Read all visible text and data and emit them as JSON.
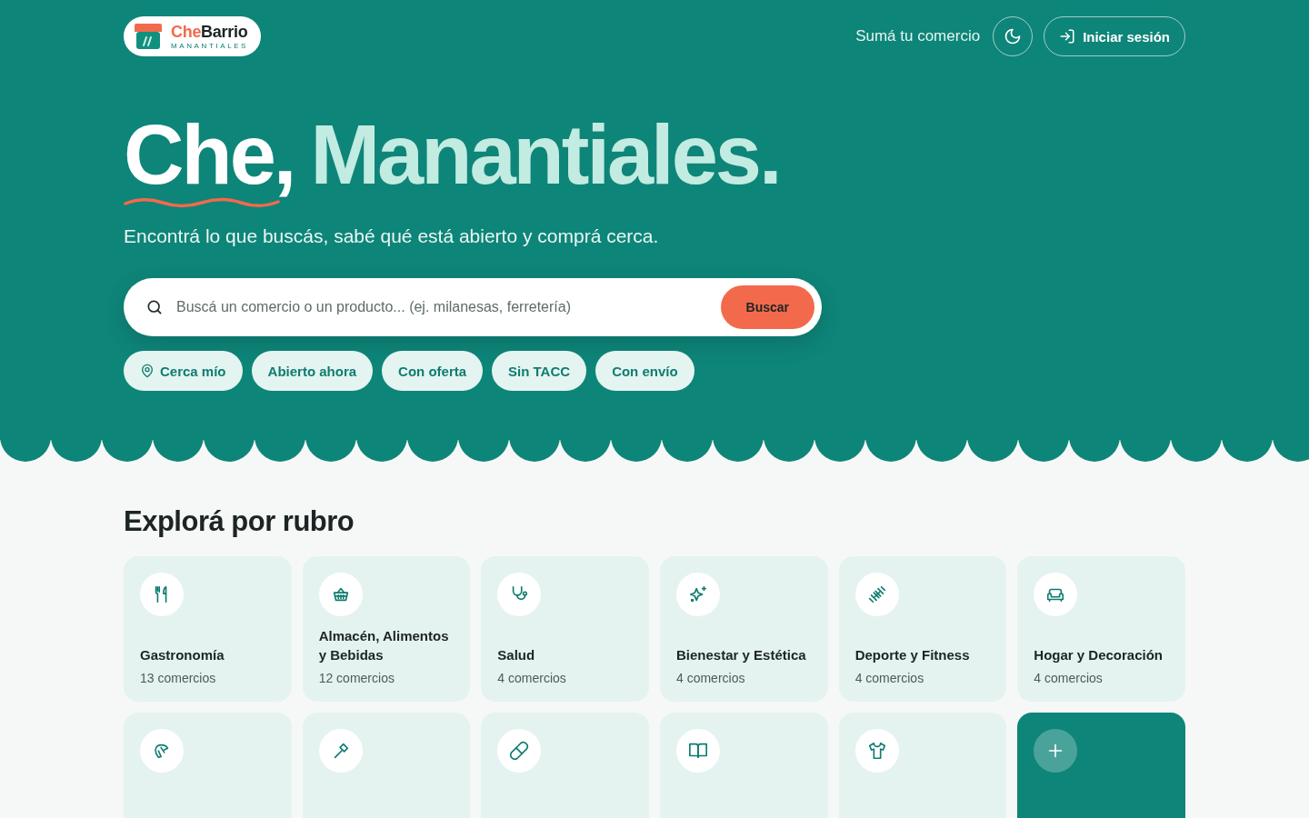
{
  "header": {
    "logo": {
      "name_first": "Che",
      "name_second": "Barrio",
      "subtitle": "MANANTIALES"
    },
    "add_business_link": "Sumá tu comercio",
    "login_button": "Iniciar sesión"
  },
  "hero": {
    "title_first": "Che,",
    "title_second": "Manantiales.",
    "subtitle": "Encontrá lo que buscás, sabé qué está abierto y comprá cerca.",
    "search": {
      "placeholder": "Buscá un comercio o un producto... (ej. milanesas, ferretería)",
      "button": "Buscar"
    },
    "filters": [
      {
        "label": "Cerca mío",
        "kind": "location"
      },
      {
        "label": "Abierto ahora",
        "kind": "plain"
      },
      {
        "label": "Con oferta",
        "kind": "plain"
      },
      {
        "label": "Sin TACC",
        "kind": "plain"
      },
      {
        "label": "Con envío",
        "kind": "plain"
      }
    ]
  },
  "categories": {
    "title": "Explorá por rubro",
    "items": [
      {
        "kind": "cutlery",
        "name": "Gastronomía",
        "count": "13 comercios"
      },
      {
        "kind": "basket",
        "name": "Almacén, Alimentos y Bebidas",
        "count": "12 comercios"
      },
      {
        "kind": "stethoscope",
        "name": "Salud",
        "count": "4 comercios"
      },
      {
        "kind": "sparkles",
        "name": "Bienestar y Estética",
        "count": "4 comercios"
      },
      {
        "kind": "dumbbell",
        "name": "Deporte y Fitness",
        "count": "4 comercios"
      },
      {
        "kind": "sofa",
        "name": "Hogar y Decoración",
        "count": "4 comercios"
      },
      {
        "kind": "croissant"
      },
      {
        "kind": "hammer"
      },
      {
        "kind": "pill"
      },
      {
        "kind": "book"
      },
      {
        "kind": "shirt"
      },
      {
        "kind": "add"
      }
    ]
  }
}
